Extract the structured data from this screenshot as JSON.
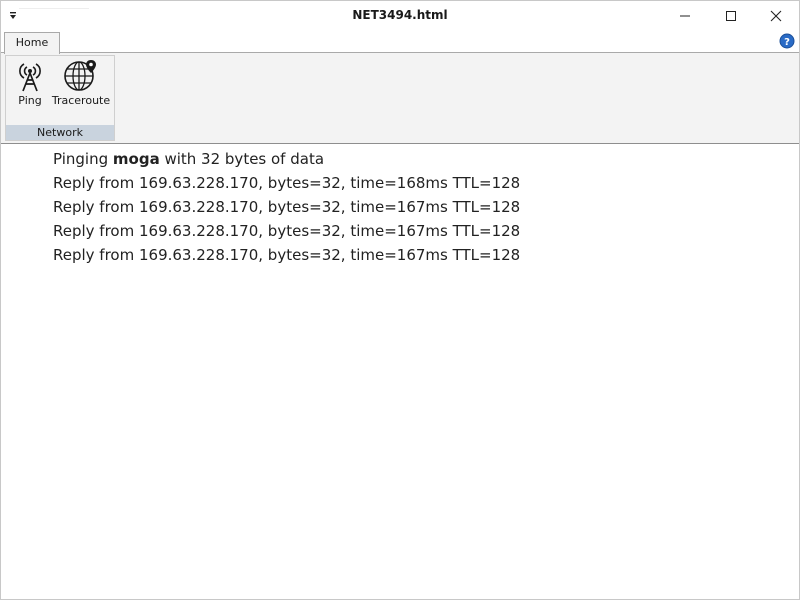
{
  "window": {
    "title": "NET3494.html"
  },
  "ribbon": {
    "tabs": [
      {
        "label": "Home",
        "active": true
      }
    ],
    "groups": [
      {
        "label": "Network",
        "buttons": [
          {
            "label": "Ping",
            "icon": "antenna-tower-icon"
          },
          {
            "label": "Traceroute",
            "icon": "globe-pin-icon"
          }
        ]
      }
    ]
  },
  "output": {
    "ping_prefix": "Pinging",
    "ping_host": "moga",
    "ping_suffix": "with 32 bytes of data",
    "replies": [
      "Reply from 169.63.228.170, bytes=32, time=168ms TTL=128",
      "Reply from 169.63.228.170, bytes=32, time=167ms TTL=128",
      "Reply from 169.63.228.170, bytes=32, time=167ms TTL=128",
      "Reply from 169.63.228.170, bytes=32, time=167ms TTL=128"
    ]
  },
  "colors": {
    "group_label_bg": "#c9d3de",
    "ribbon_bg": "#f3f3f3",
    "help_blue": "#2a6bc6"
  }
}
